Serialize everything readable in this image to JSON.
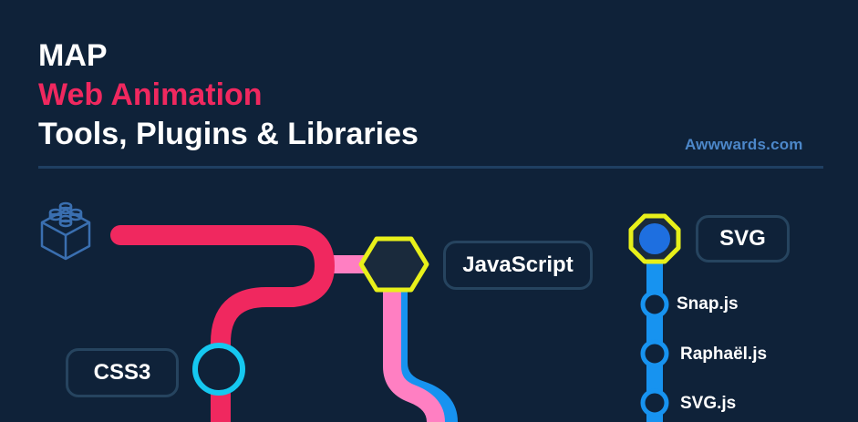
{
  "title": {
    "line1": "MAP",
    "line2": "Web Animation",
    "line3": "Tools, Plugins & Libraries"
  },
  "source": "Awwwards.com",
  "colors": {
    "background": "#0f2239",
    "accent_pink": "#f0285f",
    "light_pink": "#ff7fc2",
    "blue_line": "#1793f0",
    "cyan_stop": "#15c8f0",
    "yellow_outline": "#e8f01a",
    "divider": "#1f3f62"
  },
  "icons": {
    "logo": "lego-brick-icon"
  },
  "stations": {
    "javascript": "JavaScript",
    "svg": "SVG",
    "css3": "CSS3"
  },
  "svg_line_stops": [
    "Snap.js",
    "Raphaël.js",
    "SVG.js"
  ]
}
